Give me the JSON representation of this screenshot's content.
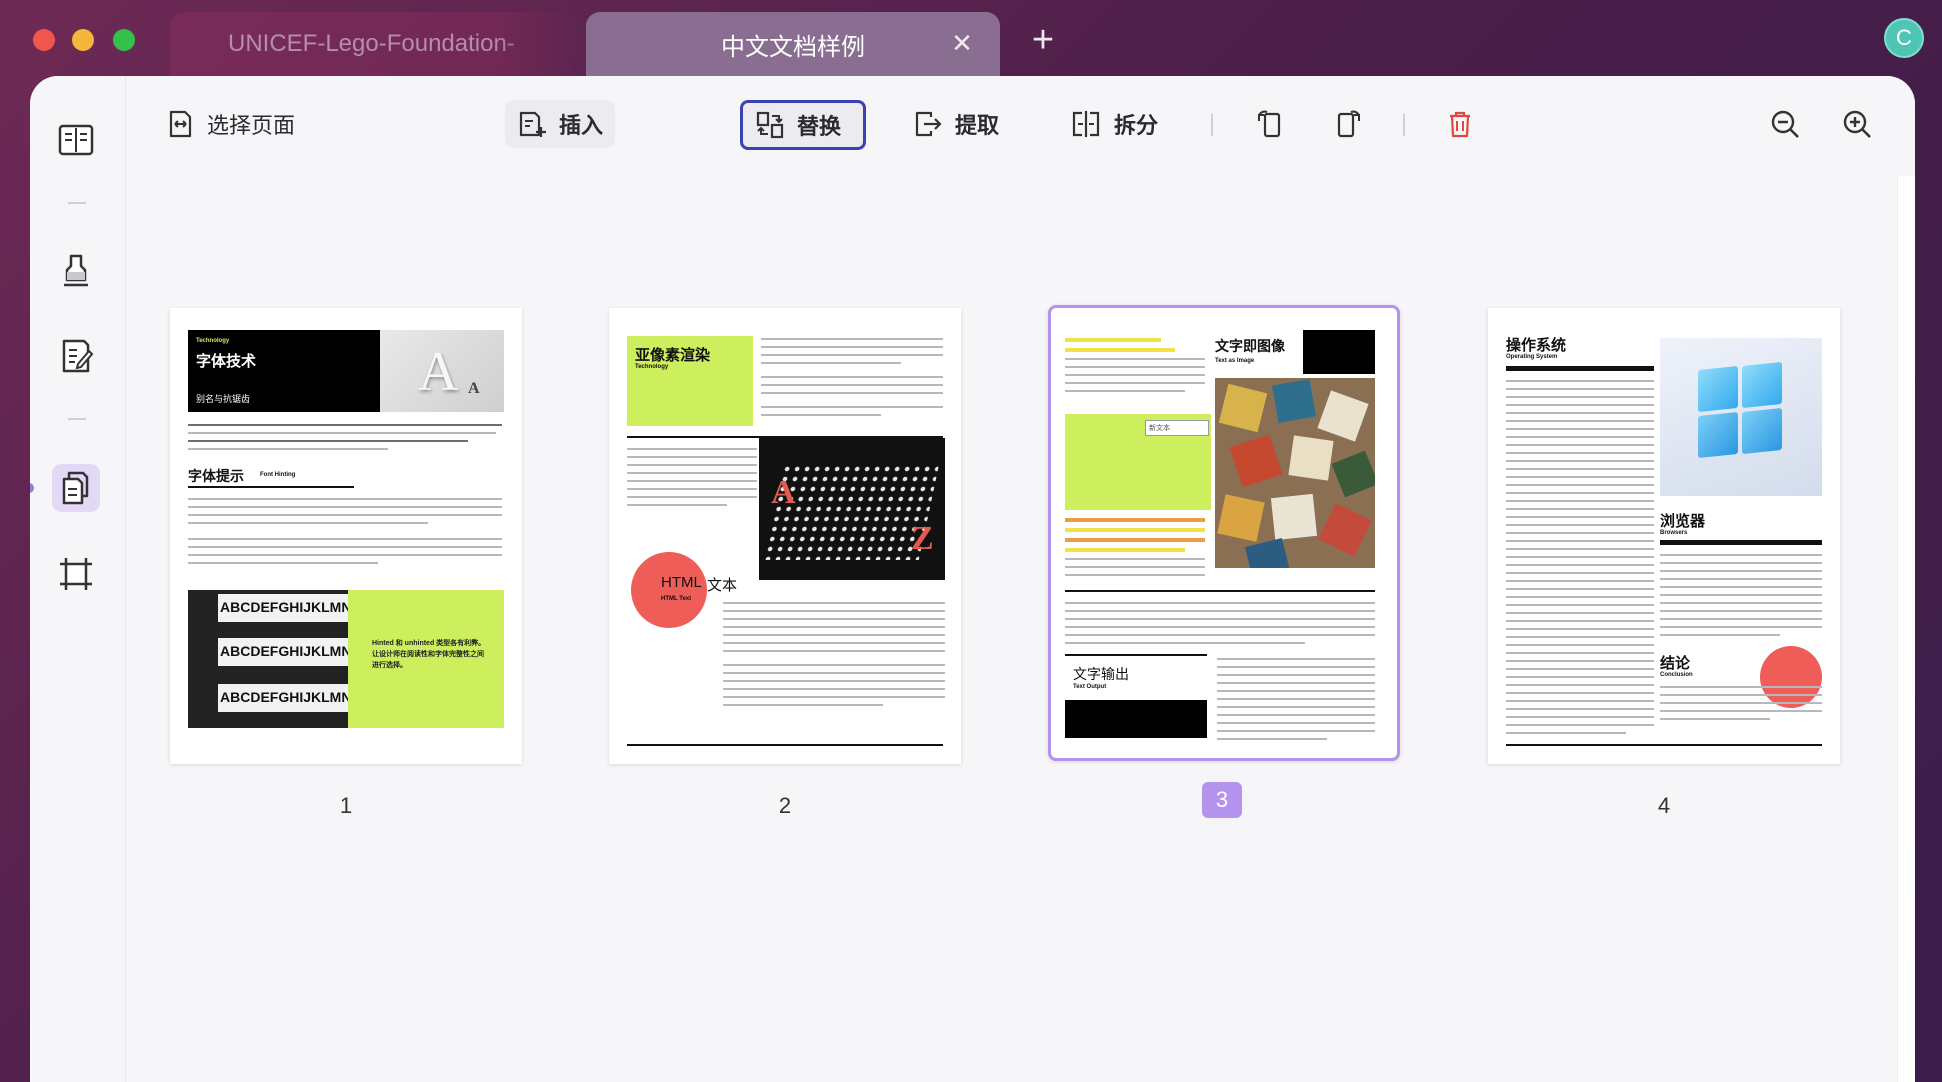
{
  "tabs": [
    {
      "label": "UNICEF-Lego-Foundation-"
    },
    {
      "label": "中文文档样例",
      "close": "✕"
    }
  ],
  "new_tab": "+",
  "user": {
    "initial": "C"
  },
  "toolbar": {
    "select_pages": "选择页面",
    "insert": "插入",
    "replace": "替换",
    "extract": "提取",
    "split": "拆分"
  },
  "pages": [
    {
      "number": "1",
      "heading_en": "Technology",
      "heading": "字体技术",
      "sub": "别名与抗锯齿",
      "glyph": "A",
      "glyph_small": "A",
      "section": "字体提示",
      "section_en": "Font Hinting",
      "strip": "ABCDEFGHIJKLMNO",
      "note": "Hinted 和 unhinted 类型各有利弊。让设计师在阅读性和字体完整性之间进行选择。"
    },
    {
      "number": "2",
      "heading": "亚像素渲染",
      "heading_en": "Technology",
      "glyph_a": "A",
      "glyph_z": "Z",
      "circle_title": "HTML",
      "circle_title_cn": "文本",
      "circle_sub": "HTML Text"
    },
    {
      "number": "3",
      "heading": "文字即图像",
      "heading_en": "Text as Image",
      "field": "新文本",
      "output": "文字输出",
      "output_en": "Text Output"
    },
    {
      "number": "4",
      "heading": "操作系统",
      "heading_en": "Operating System",
      "browsers": "浏览器",
      "browsers_en": "Browsers",
      "conclusion": "结论",
      "conclusion_en": "Conclusion"
    }
  ],
  "selected_page": "3",
  "colors": {
    "accent": "#b493ee",
    "active_border": "#3c42b4",
    "delete": "#e0473d",
    "lime": "#cdee5d"
  }
}
